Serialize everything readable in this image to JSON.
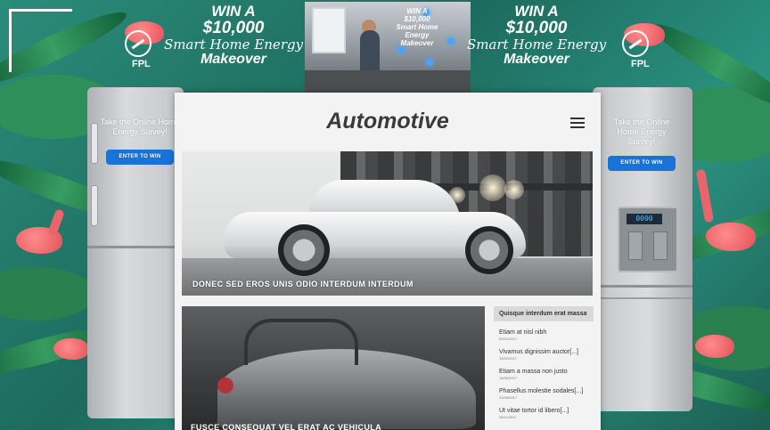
{
  "banner": {
    "left": {
      "win": "WIN A",
      "amount": "$10,000",
      "smart": "Smart Home Energy",
      "makeover": "Makeover",
      "brand": "FPL"
    },
    "right": {
      "win": "WIN A",
      "amount": "$10,000",
      "smart": "Smart Home Energy",
      "makeover": "Makeover",
      "brand": "FPL"
    },
    "video_overlay": {
      "win": "WIN A",
      "amount": "$10,000",
      "smart": "Smart Home Energy",
      "makeover": "Makeover"
    }
  },
  "fridge_left": {
    "survey_text": "Take the Online Home Energy Survey!",
    "button_label": "ENTER TO WIN"
  },
  "fridge_right": {
    "survey_text": "Take the Online Home Energy Survey!",
    "button_label": "ENTER TO WIN",
    "display": "0000"
  },
  "site": {
    "title": "Automotive",
    "hero_caption": "DONEC SED EROS UNIS ODIO INTERDUM INTERDUM",
    "second_caption": "FUSCE CONSEQUAT VEL ERAT AC VEHICULA",
    "sidebar": {
      "heading": "Quisque interdum erat massa",
      "posts": [
        {
          "title": "Etiam at nisl nibh",
          "date": "02/01/2017"
        },
        {
          "title": "Vivamus dignissim auctor[...]",
          "date": "12/02/2017"
        },
        {
          "title": "Etiam a massa non justo",
          "date": "14/06/2017"
        },
        {
          "title": "Phasellus molestie sodales[...]",
          "date": "21/06/2017"
        },
        {
          "title": "Ut vitae tortor id libero[...]",
          "date": "06/11/2017"
        }
      ]
    }
  }
}
